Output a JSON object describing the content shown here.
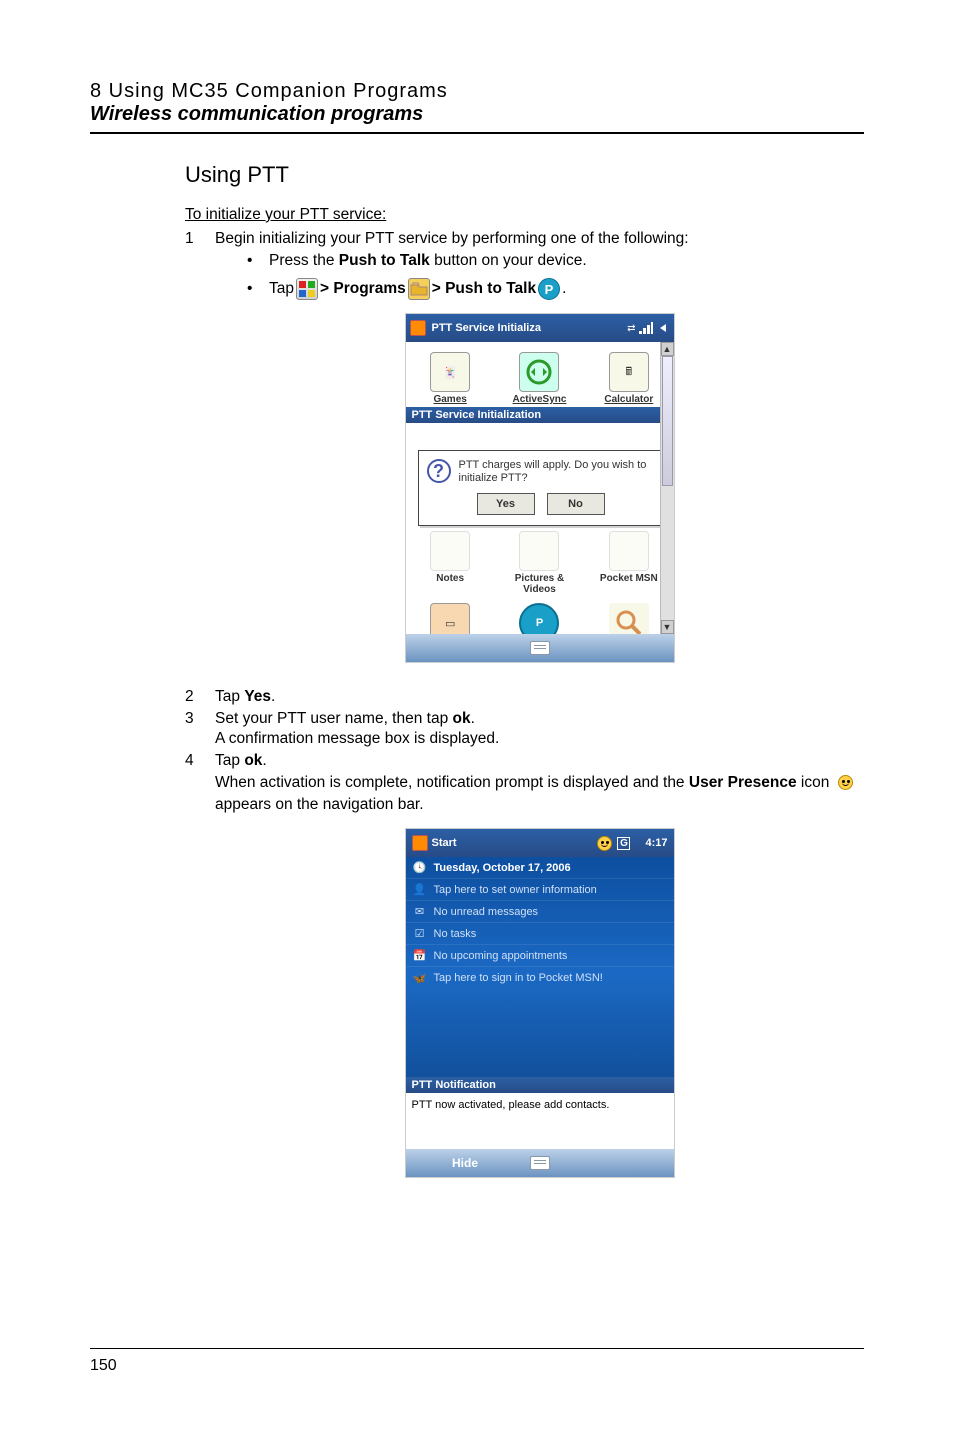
{
  "header": {
    "chapter": "8 Using MC35 Companion Programs",
    "section": "Wireless communication programs"
  },
  "heading": "Using PTT",
  "init_title": "To initialize your PTT service:",
  "steps": [
    "Begin initializing your PTT service by performing one of the following:",
    "Tap Yes.",
    "Set your PTT user name, then tap ok.",
    "Tap ok."
  ],
  "step3_sub": "A confirmation message box is displayed.",
  "step4_sub_a": "When activation is complete, notification prompt is displayed and the ",
  "step4_sub_b": "User Presence",
  "step4_sub_c": " icon ",
  "step4_sub_d": " appears on the navigation bar.",
  "bullets": {
    "b1_a": "Press the ",
    "b1_b": "Push to Talk",
    "b1_c": " button on your device.",
    "b2_a": "Tap ",
    "b2_b": " > Programs ",
    "b2_c": " > Push to Talk ",
    "b2_d": "."
  },
  "shot1": {
    "title": "PTT Service Initializa",
    "apps_row1": [
      "Games",
      "ActiveSync",
      "Calculator"
    ],
    "dlg_title": "PTT Service Initialization",
    "dlg_text": "PTT charges will apply. Do you wish to initialize PTT?",
    "btn_yes": "Yes",
    "btn_no": "No",
    "apps_row2": [
      "Notes",
      "Pictures & Videos",
      "Pocket MSN"
    ],
    "apps_row3": [
      "PowerPoint Mobile",
      "Push to Talk",
      "Search"
    ]
  },
  "shot2": {
    "start": "Start",
    "time": "4:17",
    "rows": [
      "Tuesday, October 17, 2006",
      "Tap here to set owner information",
      "No unread messages",
      "No tasks",
      "No upcoming appointments",
      "Tap here to sign in to Pocket MSN!"
    ],
    "notif_title": "PTT Notification",
    "notif_body": "PTT now activated, please add contacts.",
    "softkey": "Hide"
  },
  "footer": {
    "page": "150"
  }
}
